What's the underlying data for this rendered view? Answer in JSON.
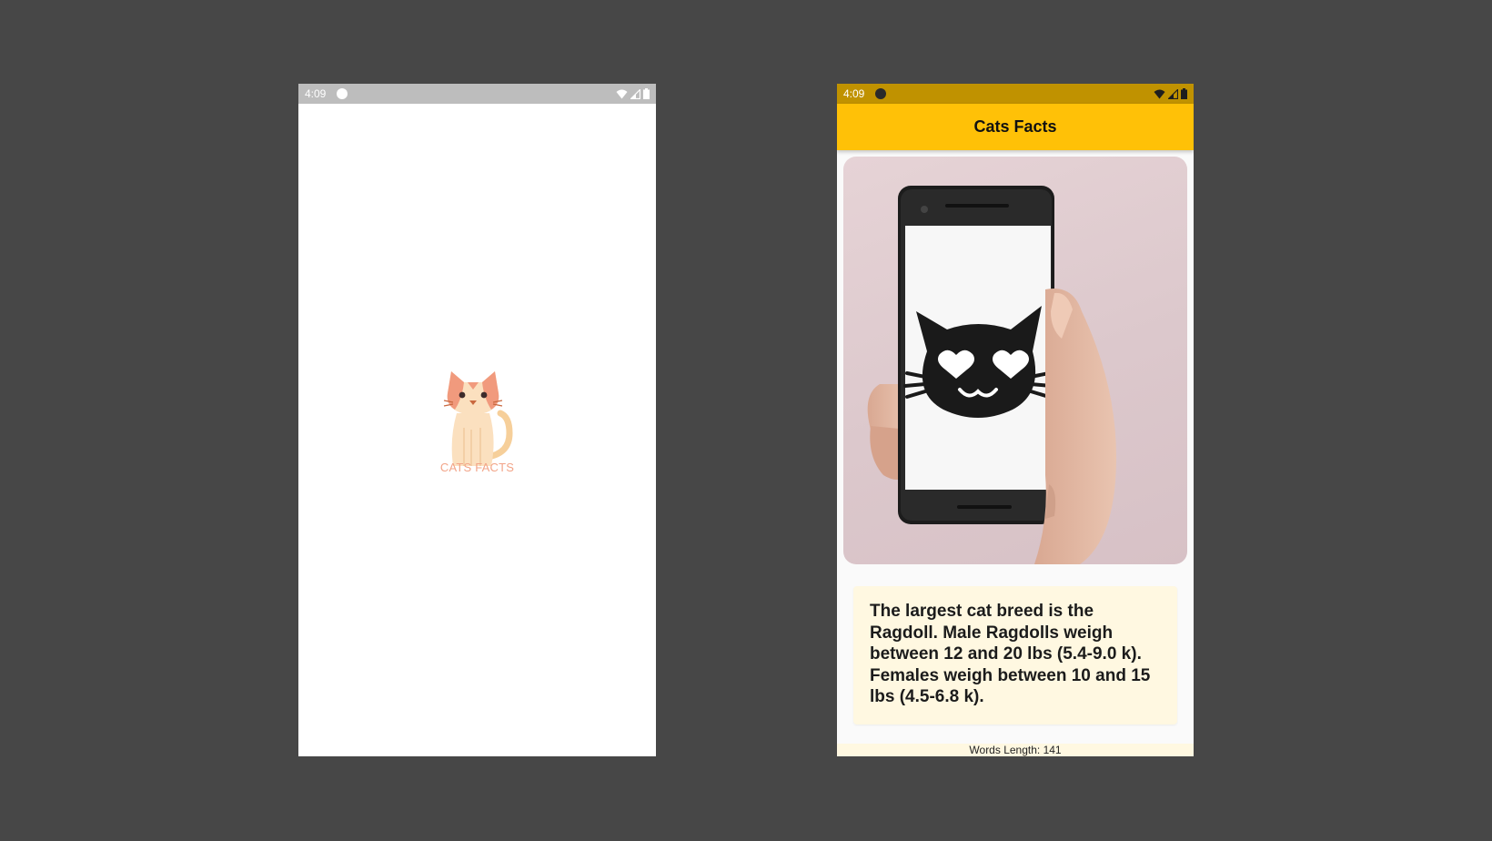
{
  "splash": {
    "status_time": "4:09",
    "caption": "CATS FACTS"
  },
  "main": {
    "status_time": "4:09",
    "title": "Cats Facts",
    "fact": "The largest cat breed is the Ragdoll. Male Ragdolls weigh between 12 and 20 lbs (5.4-9.0 k). Females weigh between 10 and 15 lbs (4.5-6.8 k).",
    "footer": "Words Length: 141"
  },
  "colors": {
    "background": "#474747",
    "accent": "#ffc107",
    "status_bar_main": "#c09200",
    "status_bar_splash": "#bdbdbd",
    "card": "#fff8e1",
    "logo_text": "#f2a488"
  },
  "icons": {
    "status_left": "app-notification-icon",
    "status_right": [
      "wifi-icon",
      "signal-icon",
      "battery-icon"
    ],
    "splash_logo": "cat-logo-icon",
    "main_image": "cat-emoji-on-phone-photo"
  }
}
